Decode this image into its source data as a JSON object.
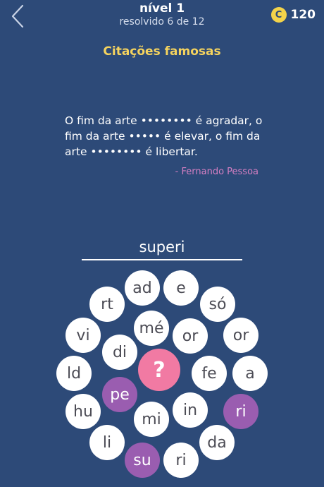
{
  "header": {
    "level_title": "nível 1",
    "level_subtitle": "resolvido 6 de 12",
    "coins": "120",
    "coin_symbol": "C",
    "back_icon": "chevron-left-icon"
  },
  "category": "Citações famosas",
  "quote": {
    "part1": "O fim da arte ",
    "blank1": "••••••••",
    "part2": " é agradar, o fim da arte ",
    "blank2": "•••••",
    "part3": " é elevar, o fim da arte ",
    "blank3": "••••••••",
    "part4": " é libertar.",
    "author": "- Fernando Pessoa"
  },
  "answer": "superi",
  "hint_label": "?",
  "colors": {
    "background": "#2d4a78",
    "accent_yellow": "#f6d45e",
    "author_pink": "#d57fc2",
    "used_bubble": "#9a5db0",
    "hint_bubble": "#f17aa3"
  },
  "bubbles": [
    "ad",
    "e",
    "rt",
    "só",
    "vi",
    "mé",
    "or",
    "or",
    "di",
    "ld",
    "fe",
    "a",
    "pe",
    "hu",
    "in",
    "ri",
    "mi",
    "li",
    "da",
    "su",
    "ri"
  ]
}
